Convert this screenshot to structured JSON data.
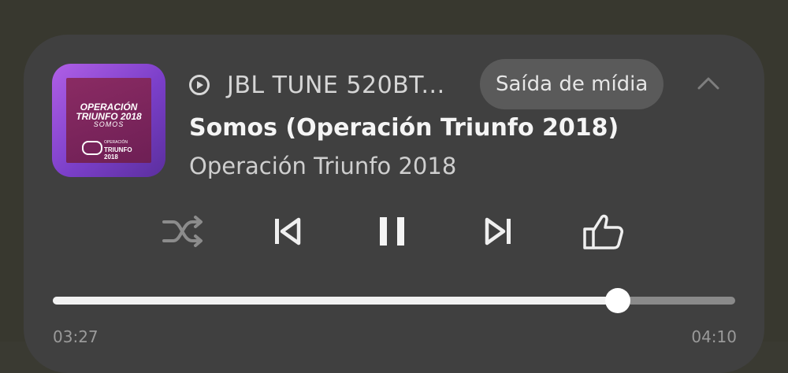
{
  "media": {
    "device_name": "JBL TUNE 520BT...",
    "output_button_label": "Saída de mídia",
    "song_title": "Somos (Operación Triunfo 2018)",
    "artist": "Operación Triunfo 2018",
    "album_art": {
      "line1": "OPERACIÓN",
      "line2": "TRIUNFO 2018",
      "line3": "SOMOS",
      "logo_text_top": "OPERACIÓN",
      "logo_text_mid": "TRIUNFO",
      "logo_text_bot": "2018"
    },
    "elapsed": "03:27",
    "total": "04:10",
    "progress_fraction": 0.828
  },
  "controls": [
    {
      "name": "shuffle-icon"
    },
    {
      "name": "previous-icon"
    },
    {
      "name": "pause-icon"
    },
    {
      "name": "next-icon"
    },
    {
      "name": "thumbs-up-icon"
    }
  ],
  "colors": {
    "card_bg": "#404040",
    "accent": "#f2f2f2",
    "track": "#8a8a8a"
  }
}
